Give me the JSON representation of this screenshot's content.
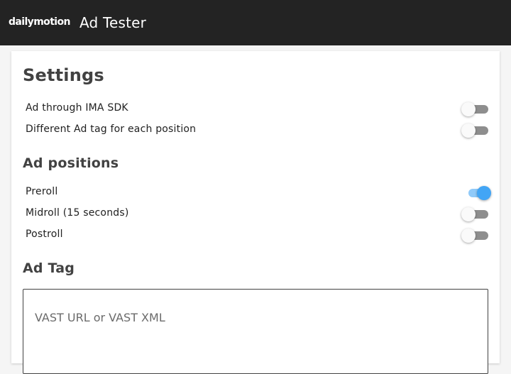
{
  "header": {
    "logo_text": "dailymotion",
    "title": "Ad Tester",
    "background": "#232323"
  },
  "settings": {
    "title": "Settings",
    "toggles": [
      {
        "label": "Ad through IMA SDK",
        "on": false
      },
      {
        "label": "Different Ad tag for each position",
        "on": false
      }
    ]
  },
  "ad_positions": {
    "title": "Ad positions",
    "toggles": [
      {
        "label": "Preroll",
        "on": true
      },
      {
        "label": "Midroll (15 seconds)",
        "on": false
      },
      {
        "label": "Postroll",
        "on": false
      }
    ]
  },
  "ad_tag": {
    "title": "Ad Tag",
    "placeholder": "VAST URL or VAST XML",
    "value": ""
  },
  "colors": {
    "toggle_on": "#42a5f5",
    "toggle_on_track": "#90caf9",
    "toggle_off_track": "#8e8e8e"
  }
}
